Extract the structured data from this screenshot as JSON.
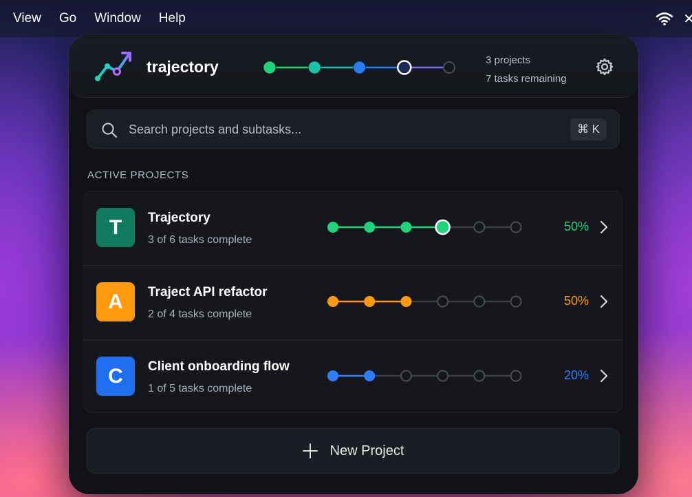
{
  "menubar": {
    "items": [
      "View",
      "Go",
      "Window",
      "Help"
    ]
  },
  "app": {
    "title": "trajectory",
    "stats": {
      "projects": "3 projects",
      "tasks": "7 tasks remaining"
    },
    "header_progress": {
      "total": 5,
      "done": 3,
      "current": 4
    }
  },
  "search": {
    "placeholder": "Search projects and subtasks...",
    "value": "",
    "shortcut": "⌘ K"
  },
  "section": {
    "label": "ACTIVE PROJECTS"
  },
  "projects": [
    {
      "letter": "T",
      "name": "Trajectory",
      "subtitle": "3 of 6 tasks complete",
      "percent": "50%",
      "color": "#1fd37a",
      "avatar_color": "#0f7a5e",
      "steps": 6,
      "done": 3,
      "current": true
    },
    {
      "letter": "A",
      "name": "Traject API refactor",
      "subtitle": "2 of 4 tasks complete",
      "percent": "50%",
      "color": "#ff9a0e",
      "avatar_color": "#ff9a0e",
      "steps": 6,
      "done": 3,
      "current": false
    },
    {
      "letter": "C",
      "name": "Client onboarding flow",
      "subtitle": "1 of 5 tasks complete",
      "percent": "20%",
      "color": "#2f7dff",
      "avatar_color": "#1f6ff0",
      "steps": 6,
      "done": 2,
      "current": false
    }
  ],
  "new_project": {
    "label": "New Project"
  },
  "icons": {
    "logo": "trajectory-logo",
    "gear": "gear-icon",
    "search": "search-icon",
    "chevron": "chevron-right-icon",
    "plus": "plus-icon",
    "wifi": "wifi-icon"
  }
}
